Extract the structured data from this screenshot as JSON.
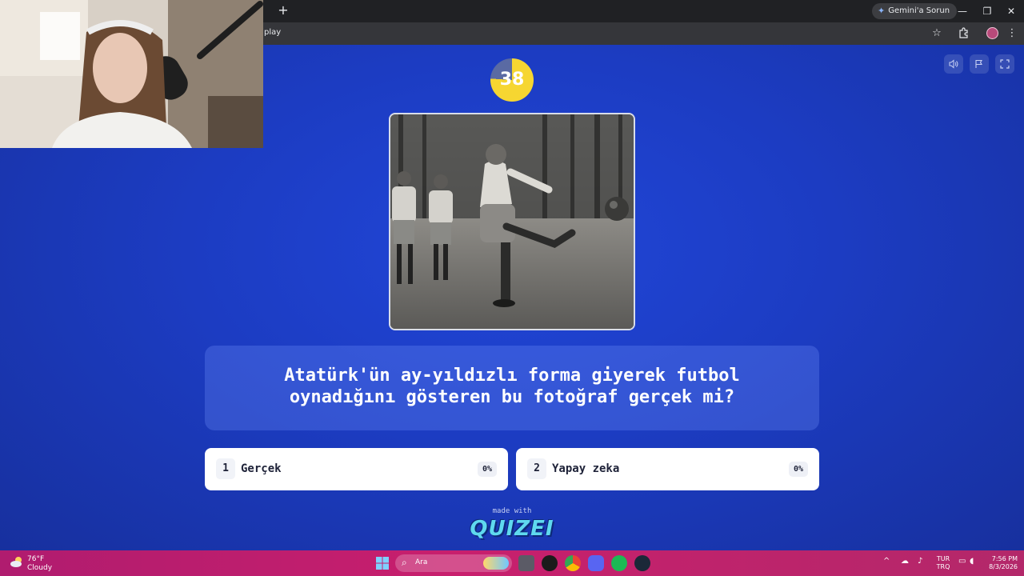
{
  "browser": {
    "new_tab": "+",
    "gemini_label": "Gemini'a Sorun",
    "url": "play",
    "window_controls": {
      "minimize": "—",
      "maximize": "❐",
      "close": "✕"
    }
  },
  "quiz": {
    "timer": "38",
    "timer_progress": 0.76,
    "question": "Atatürk'ün ay-yıldızlı forma giyerek futbol oynadığını gösteren bu fotoğraf gerçek mi?",
    "answers": [
      {
        "number": "1",
        "label": "Gerçek",
        "percent": "0%"
      },
      {
        "number": "2",
        "label": "Yapay zeka",
        "percent": "0%"
      }
    ],
    "made_with": "made with",
    "brand": "QUIZEI",
    "controls": [
      "volume-icon",
      "flag-icon",
      "fullscreen-icon"
    ]
  },
  "taskbar": {
    "weather_temp": "76°F",
    "weather_desc": "Cloudy",
    "search_placeholder": "Ara",
    "lang_top": "TUR",
    "lang_bottom": "TRQ",
    "time": "7:56 PM",
    "date": "8/3/2026"
  },
  "colors": {
    "page_blue": "#1c3cc2",
    "timer_yellow": "#f6d631",
    "brand_cyan": "#5fd9ef",
    "taskbar_pink": "#c81f6d"
  }
}
